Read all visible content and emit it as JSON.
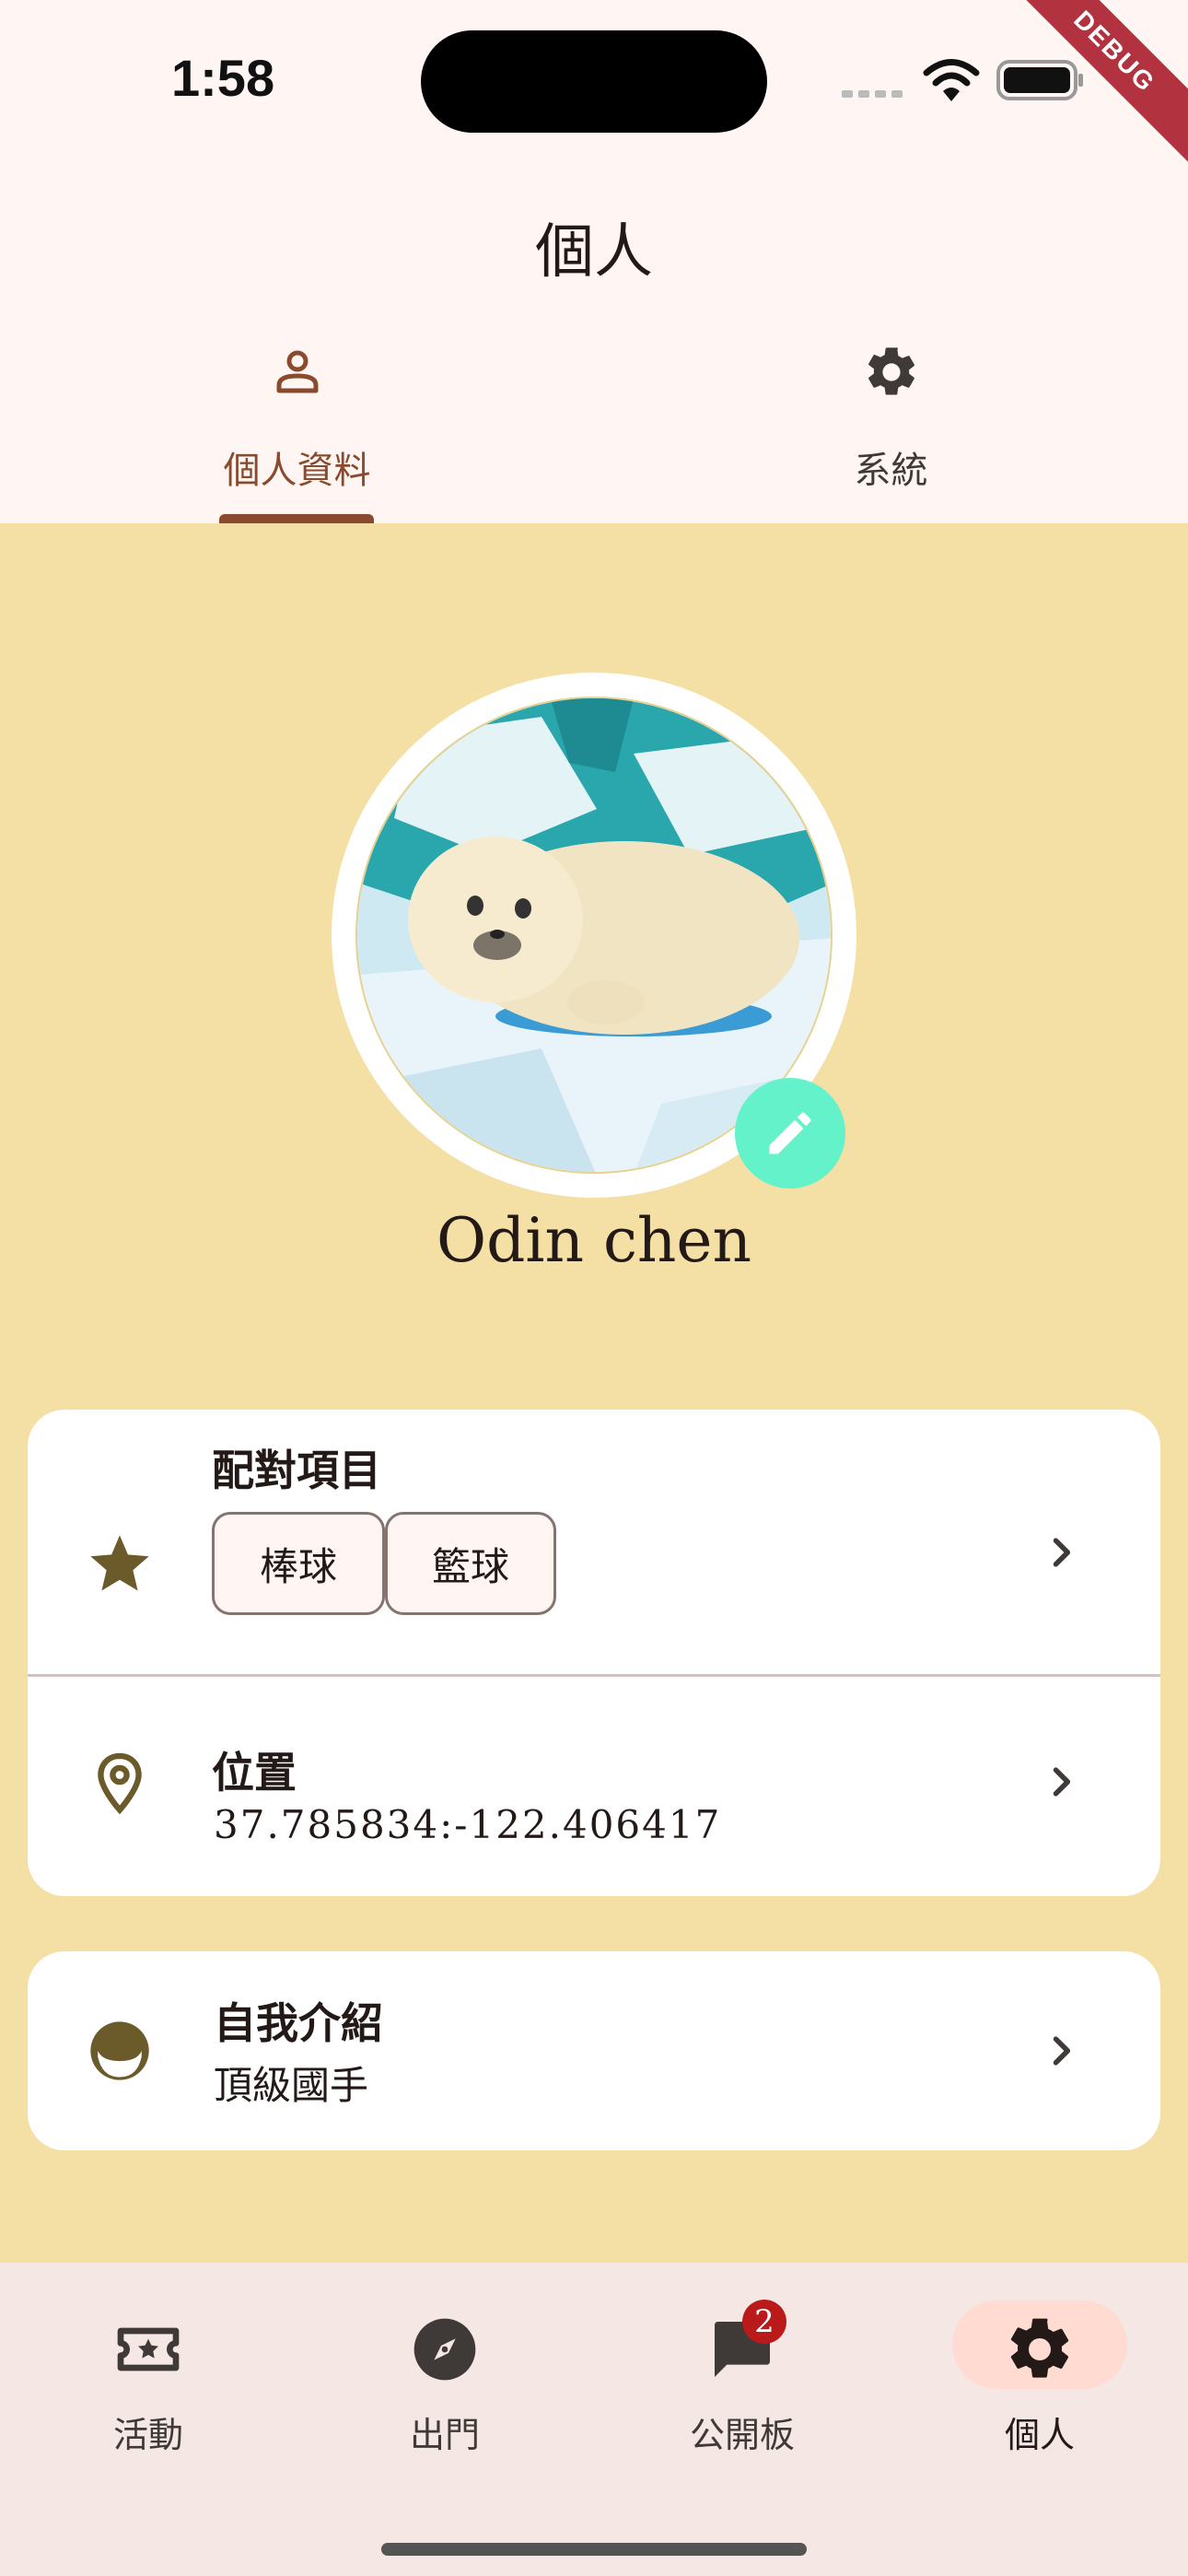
{
  "status_bar": {
    "time": "1:58",
    "debug_label": "DEBUG"
  },
  "header": {
    "title": "個人"
  },
  "tabs": [
    {
      "label": "個人資料",
      "icon": "person-icon",
      "selected": true
    },
    {
      "label": "系統",
      "icon": "gear-icon",
      "selected": false
    }
  ],
  "profile": {
    "name": "Odin chen",
    "avatar": "seal-avatar-image"
  },
  "match_items": {
    "title": "配對項目",
    "chips": [
      "棒球",
      "籃球"
    ]
  },
  "location": {
    "title": "位置",
    "value": "37.785834:-122.406417"
  },
  "intro": {
    "title": "自我介紹",
    "value": "頂級國手"
  },
  "bottom_nav": [
    {
      "label": "活動",
      "icon": "ticket-star-icon"
    },
    {
      "label": "出門",
      "icon": "compass-icon"
    },
    {
      "label": "公開板",
      "icon": "chat-bubble-icon",
      "badge": "2"
    },
    {
      "label": "個人",
      "icon": "gear-icon",
      "selected": true
    }
  ],
  "colors": {
    "accent": "#8a4a2e",
    "main_bg": "#f4dfa5",
    "fab": "#63f2c9",
    "nav_pill": "#ffdbd1",
    "badge": "#ba1a1a"
  }
}
